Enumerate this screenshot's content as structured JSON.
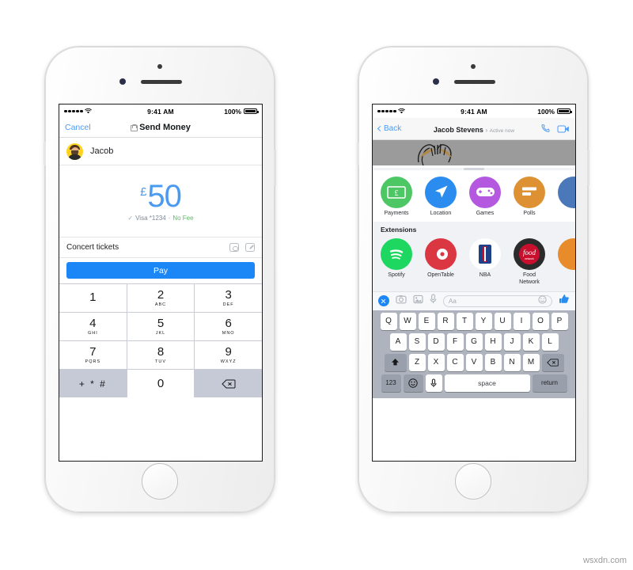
{
  "page": {
    "watermark": "wsxdn.com"
  },
  "left_phone": {
    "status_bar": {
      "time": "9:41 AM",
      "battery": "100%",
      "signal_dots": 5,
      "wifi": "wifi-icon"
    },
    "navbar": {
      "cancel": "Cancel",
      "title": "Send Money",
      "lock_icon": "lock-icon"
    },
    "recipient": {
      "name": "Jacob",
      "avatar": "user-avatar"
    },
    "amount": {
      "currency": "£",
      "value": "50",
      "color": "#4a9bf0"
    },
    "payment_source": {
      "check": "✓",
      "card": "Visa *1234",
      "separator": "·",
      "fee": "No Fee",
      "fee_color": "#5dbb63"
    },
    "memo": {
      "text": "Concert tickets",
      "camera_icon": "camera-icon",
      "edit_icon": "edit-icon"
    },
    "pay_button": {
      "label": "Pay",
      "color": "#1b87f7"
    },
    "keypad": [
      {
        "num": "1",
        "sub": ""
      },
      {
        "num": "2",
        "sub": "ABC"
      },
      {
        "num": "3",
        "sub": "DEF"
      },
      {
        "num": "4",
        "sub": "GHI"
      },
      {
        "num": "5",
        "sub": "JKL"
      },
      {
        "num": "6",
        "sub": "MNO"
      },
      {
        "num": "7",
        "sub": "PQRS"
      },
      {
        "num": "8",
        "sub": "TUV"
      },
      {
        "num": "9",
        "sub": "WXYZ"
      },
      {
        "num": "+ * #",
        "sub": ""
      },
      {
        "num": "0",
        "sub": ""
      },
      {
        "num": "",
        "sub": ""
      }
    ]
  },
  "right_phone": {
    "status_bar": {
      "time": "9:41 AM",
      "battery": "100%",
      "signal_dots": 5,
      "wifi": "wifi-icon"
    },
    "navbar": {
      "back": "Back",
      "contact_name": "Jacob Stevens",
      "name_arrow": "›",
      "status": "Active now",
      "call_icon": "phone-icon",
      "video_icon": "video-camera-icon"
    },
    "apps": [
      {
        "label": "Payments",
        "color": "#4cc764",
        "icon": "money-note-icon"
      },
      {
        "label": "Location",
        "color": "#2b8cf0",
        "icon": "location-arrow-icon"
      },
      {
        "label": "Games",
        "color": "#b558e0",
        "icon": "gamepad-icon"
      },
      {
        "label": "Polls",
        "color": "#dd9132",
        "icon": "poll-bars-icon"
      },
      {
        "label": "",
        "color": "#4a78b8",
        "icon": "partial-app-icon"
      }
    ],
    "extensions_header": "Extensions",
    "extensions": [
      {
        "label": "Spotify",
        "color": "#1ed760",
        "icon": "spotify-icon"
      },
      {
        "label": "OpenTable",
        "color": "#da3743",
        "icon": "opentable-icon"
      },
      {
        "label": "NBA",
        "color": "#ffffff",
        "icon": "nba-icon"
      },
      {
        "label": "Food Network",
        "color": "#c8102e",
        "icon": "food-network-icon"
      },
      {
        "label": "",
        "color": "#e88b2a",
        "icon": "partial-extension-icon"
      }
    ],
    "composer": {
      "close_icon": "close-icon",
      "camera_icon": "camera-icon",
      "photo_icon": "photo-icon",
      "mic_icon": "microphone-icon",
      "placeholder": "Aa",
      "emoji_icon": "smiley-icon",
      "thumb_icon": "thumbs-up-icon"
    },
    "keyboard": {
      "row1": [
        "Q",
        "W",
        "E",
        "R",
        "T",
        "Y",
        "U",
        "I",
        "O",
        "P"
      ],
      "row2": [
        "A",
        "S",
        "D",
        "F",
        "G",
        "H",
        "J",
        "K",
        "L"
      ],
      "row3": [
        "Z",
        "X",
        "C",
        "V",
        "B",
        "N",
        "M"
      ],
      "shift": "shift-icon",
      "backspace": "backspace-icon",
      "numbers": "123",
      "emoji": "emoji-icon",
      "mic": "microphone-icon",
      "space": "space",
      "return": "return"
    }
  }
}
